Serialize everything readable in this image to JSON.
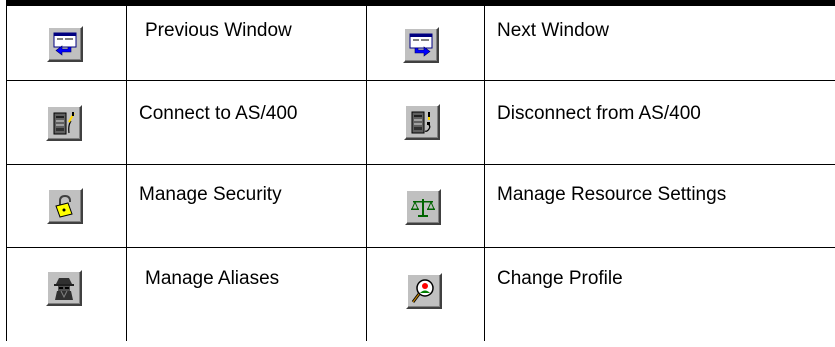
{
  "rows": [
    {
      "left": {
        "icon": "previous-window-icon",
        "label": "Previous Window"
      },
      "right": {
        "icon": "next-window-icon",
        "label": "Next Window"
      }
    },
    {
      "left": {
        "icon": "connect-icon",
        "label": "Connect to AS/400"
      },
      "right": {
        "icon": "disconnect-icon",
        "label": "Disconnect from AS/400"
      }
    },
    {
      "left": {
        "icon": "lock-icon",
        "label": "Manage Security"
      },
      "right": {
        "icon": "scale-icon",
        "label": "Manage Resource Settings"
      }
    },
    {
      "left": {
        "icon": "spy-icon",
        "label": "Manage Aliases"
      },
      "right": {
        "icon": "profile-magnifier-icon",
        "label": "Change Profile"
      }
    }
  ]
}
